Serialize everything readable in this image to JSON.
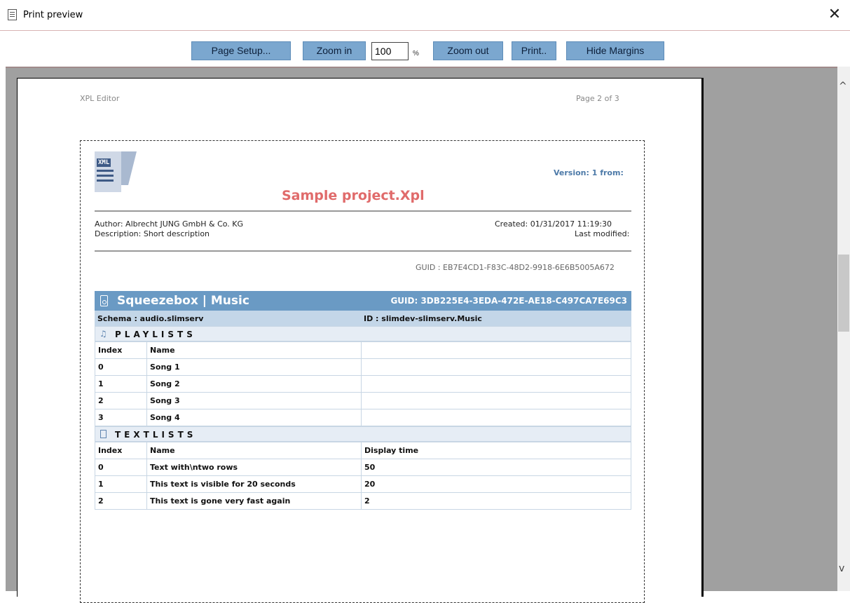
{
  "window": {
    "title": "Print preview",
    "close_glyph": "✕"
  },
  "toolbar": {
    "page_setup": "Page Setup...",
    "zoom_in": "Zoom in",
    "zoom_value": "100",
    "zoom_unit": "%",
    "zoom_out": "Zoom out",
    "print": "Print..",
    "hide_margins": "Hide Margins"
  },
  "page": {
    "header_left": "XPL Editor",
    "header_right": "Page 2 of 3",
    "version": "Version: 1 from:",
    "project_title": "Sample project.Xpl",
    "logo_text": "XML",
    "author": "Author: Albrecht JUNG GmbH & Co. KG",
    "description": "Description: Short description",
    "created": "Created: 01/31/2017 11:19:30",
    "last_modified": "Last modified:",
    "guid": "GUID : EB7E4CD1-F83C-48D2-9918-6E6B5005A672"
  },
  "device": {
    "name": "Squeezebox | Music",
    "guid": "GUID: 3DB225E4-3EDA-472E-AE18-C497CA7E69C3",
    "schema": "Schema : audio.slimserv",
    "id": "ID : slimdev-slimserv.Music",
    "playlists": {
      "title": "PLAYLISTS",
      "icon": "♫",
      "headers": [
        "Index",
        "Name",
        ""
      ],
      "rows": [
        [
          "0",
          "Song 1",
          ""
        ],
        [
          "1",
          "Song 2",
          ""
        ],
        [
          "2",
          "Song 3",
          ""
        ],
        [
          "3",
          "Song 4",
          ""
        ]
      ]
    },
    "textlists": {
      "title": "TEXTLISTS",
      "headers": [
        "Index",
        "Name",
        "Display time"
      ],
      "rows": [
        [
          "0",
          "Text with\\ntwo rows",
          "50"
        ],
        [
          "1",
          "This text is visible for 20 seconds",
          "20"
        ],
        [
          "2",
          "This text is gone very fast again",
          "2"
        ]
      ]
    }
  },
  "icons": {
    "window_icon": "document-icon",
    "device_icon": "speaker-icon",
    "playlist_icon": "music-note-icon",
    "textlist_icon": "text-document-icon",
    "scroll_up": "^",
    "scroll_down": "v"
  },
  "colors": {
    "button_bg": "#7ba7cf",
    "device_header": "#6a9ac4",
    "schema_row": "#c3d6e8",
    "title_red": "#e06b6b",
    "version_blue": "#4d7aa8"
  }
}
